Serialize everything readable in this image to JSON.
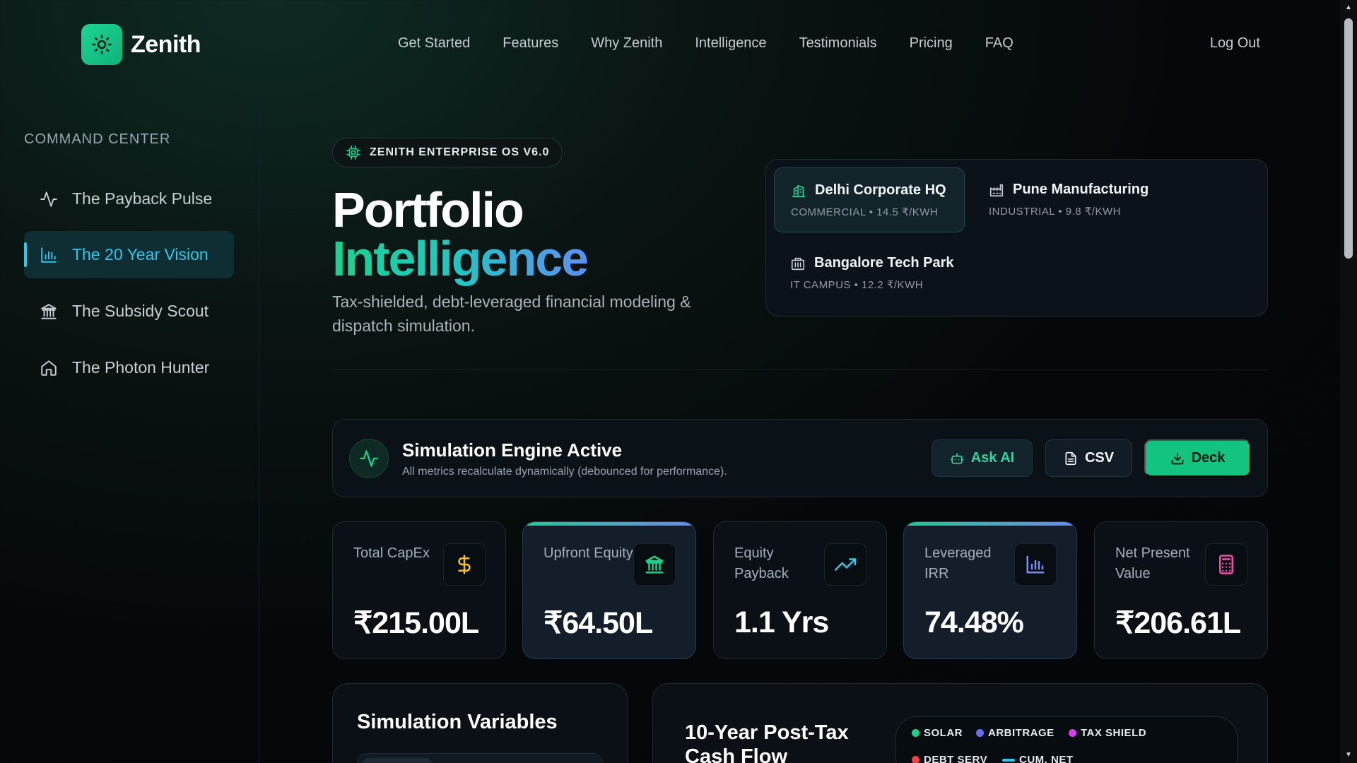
{
  "brand": {
    "name": "Zenith",
    "logo_icon": "sun-icon",
    "accent": "#12c47f"
  },
  "nav": {
    "links": [
      "Get Started",
      "Features",
      "Why Zenith",
      "Intelligence",
      "Testimonials",
      "Pricing",
      "FAQ"
    ],
    "logout": "Log Out"
  },
  "sidebar": {
    "title": "COMMAND CENTER",
    "items": [
      {
        "label": "The Payback Pulse",
        "icon": "activity-icon",
        "active": false
      },
      {
        "label": "The 20 Year Vision",
        "icon": "bar-chart-icon",
        "active": true
      },
      {
        "label": "The Subsidy Scout",
        "icon": "bank-icon",
        "active": false
      },
      {
        "label": "The Photon Hunter",
        "icon": "home-icon",
        "active": false
      }
    ]
  },
  "hero": {
    "badge": "ZENITH ENTERPRISE OS V6.0",
    "title_line1": "Portfolio",
    "title_line2": "Intelligence",
    "subtitle": "Tax-shielded, debt-leveraged financial modeling & dispatch simulation."
  },
  "sites": [
    {
      "name": "Delhi Corporate HQ",
      "meta": "COMMERCIAL • 14.5 ₹/KWH",
      "icon": "building-icon",
      "active": true
    },
    {
      "name": "Pune Manufacturing",
      "meta": "INDUSTRIAL • 9.8 ₹/KWH",
      "icon": "factory-icon",
      "active": false
    },
    {
      "name": "Bangalore Tech Park",
      "meta": "IT CAMPUS • 12.2 ₹/KWH",
      "icon": "office-icon",
      "active": false
    }
  ],
  "simulation": {
    "title": "Simulation Engine Active",
    "description": "All metrics recalculate dynamically (debounced for performance).",
    "buttons": {
      "ask_ai": "Ask AI",
      "csv": "CSV",
      "deck": "Deck"
    }
  },
  "kpis": [
    {
      "label": "Total CapEx",
      "value": "₹215.00L",
      "icon": "dollar-icon",
      "icon_color": "#f2c230",
      "highlight": false
    },
    {
      "label": "Upfront Equity",
      "value": "₹64.50L",
      "icon": "bank-icon",
      "icon_color": "#19d28c",
      "highlight": true
    },
    {
      "label": "Equity Payback",
      "value": "1.1 Yrs",
      "icon": "trending-up-icon",
      "icon_color": "#2fc7e6",
      "highlight": false
    },
    {
      "label": "Leveraged IRR",
      "value": "74.48%",
      "icon": "bar-chart-icon",
      "icon_color": "#7b8cf5",
      "highlight": true
    },
    {
      "label": "Net Present Value",
      "value": "₹206.61L",
      "icon": "calculator-icon",
      "icon_color": "#ef4fa6",
      "highlight": false
    }
  ],
  "panels": {
    "variables_title": "Simulation Variables",
    "cashflow_title": "10-Year Post-Tax Cash Flow",
    "legend": [
      {
        "label": "SOLAR",
        "color": "#1bd08c",
        "shape": "dot"
      },
      {
        "label": "ARBITRAGE",
        "color": "#6c6cf0",
        "shape": "dot"
      },
      {
        "label": "TAX SHIELD",
        "color": "#d63ee8",
        "shape": "dot"
      },
      {
        "label": "DEBT SERV",
        "color": "#ef4444",
        "shape": "dot"
      },
      {
        "label": "CUM. NET",
        "color": "#2fc7e6",
        "shape": "line"
      }
    ]
  }
}
